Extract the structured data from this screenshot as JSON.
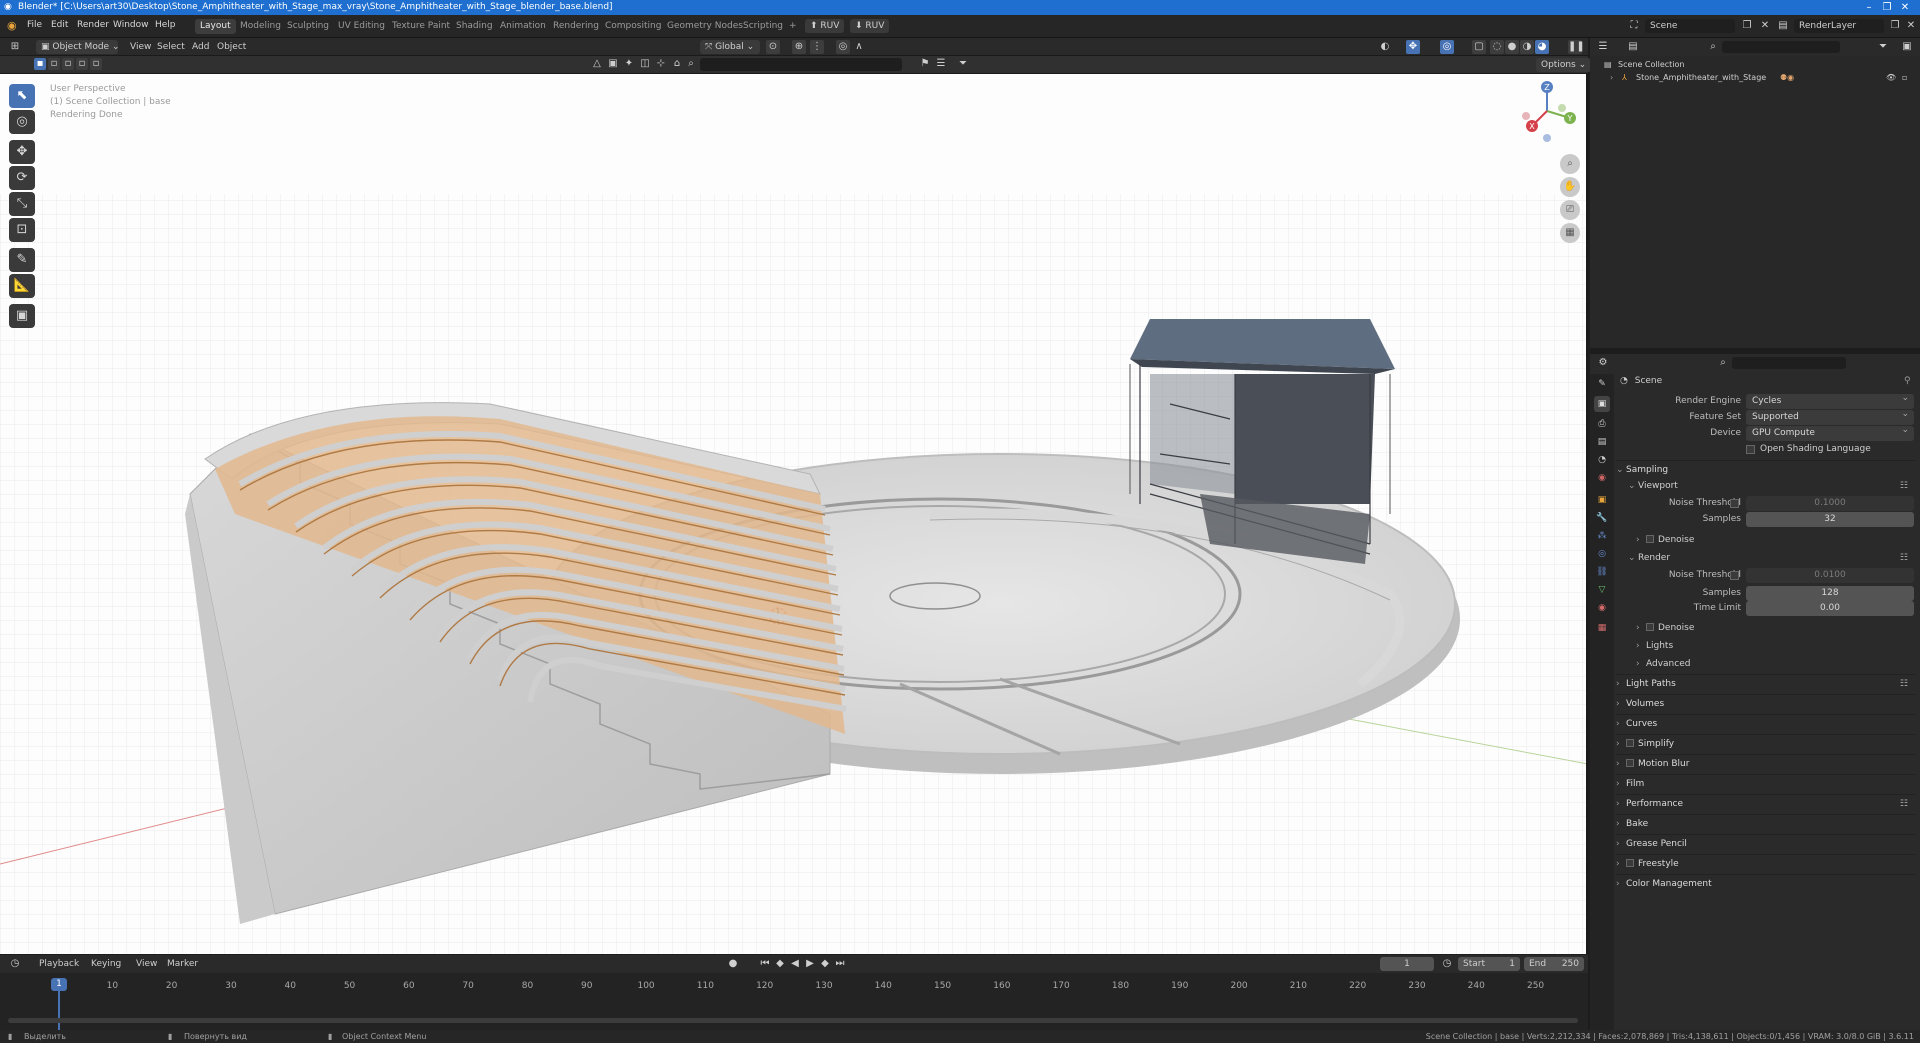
{
  "window": {
    "title": "Blender* [C:\\Users\\art30\\Desktop\\Stone_Amphitheater_with_Stage_max_vray\\Stone_Amphitheater_with_Stage_blender_base.blend]",
    "minimize": "–",
    "maximize": "❐",
    "close": "✕"
  },
  "menus": [
    "File",
    "Edit",
    "Render",
    "Window",
    "Help"
  ],
  "workspaces": [
    "Layout",
    "Modeling",
    "Sculpting",
    "UV Editing",
    "Texture Paint",
    "Shading",
    "Animation",
    "Rendering",
    "Compositing",
    "Geometry Nodes",
    "Scripting"
  ],
  "workspace_add": "+",
  "ruv_labels": [
    "RUV",
    "RUV"
  ],
  "scene_selector": "Scene",
  "view_layer": "RenderLayer",
  "viewport_header": {
    "mode": "Object Mode",
    "menus": [
      "View",
      "Select",
      "Add",
      "Object"
    ],
    "transform": "Global",
    "options": "Options"
  },
  "viewport_info": {
    "line1": "User Perspective",
    "line2": "(1) Scene Collection | base",
    "line3": "Rendering Done"
  },
  "gizmo": {
    "x": "X",
    "y": "Y",
    "z": "Z"
  },
  "outliner": {
    "root": "Scene Collection",
    "child": "Stone_Amphitheater_with_Stage"
  },
  "properties": {
    "context": "Scene",
    "render_engine_label": "Render Engine",
    "render_engine": "Cycles",
    "feature_set_label": "Feature Set",
    "feature_set": "Supported",
    "device_label": "Device",
    "device": "GPU Compute",
    "osl": "Open Shading Language",
    "sampling": "Sampling",
    "viewport": "Viewport",
    "noise_threshold_label": "Noise Threshold",
    "vp_noise_threshold": "0.1000",
    "samples_label": "Samples",
    "vp_samples": "32",
    "denoise": "Denoise",
    "render": "Render",
    "r_noise_threshold": "0.0100",
    "r_samples": "128",
    "time_limit_label": "Time Limit",
    "time_limit": "0.00",
    "lights": "Lights",
    "advanced": "Advanced",
    "panels": [
      "Light Paths",
      "Volumes",
      "Curves",
      "Simplify",
      "Motion Blur",
      "Film",
      "Performance",
      "Bake",
      "Grease Pencil",
      "Freestyle",
      "Color Management"
    ]
  },
  "timeline": {
    "menus": [
      "Playback",
      "Keying",
      "View",
      "Marker"
    ],
    "current_frame": "1",
    "start_label": "Start",
    "start": "1",
    "end_label": "End",
    "end": "250",
    "playhead": "1",
    "ticks": [
      "10",
      "20",
      "30",
      "40",
      "50",
      "60",
      "70",
      "80",
      "90",
      "100",
      "110",
      "120",
      "130",
      "140",
      "150",
      "160",
      "170",
      "180",
      "190",
      "200",
      "210",
      "220",
      "230",
      "240",
      "250"
    ]
  },
  "status": {
    "select": "Выделить",
    "rotate": "Повернуть вид",
    "context_menu": "Object Context Menu",
    "stats": "Scene Collection | base | Verts:2,212,334 | Faces:2,078,869 | Tris:4,138,611 | Objects:0/1,456 | VRAM: 3.0/8.0 GiB | 3.6.11"
  },
  "colors": {
    "titlebar": "#1e6fcf",
    "accent": "#4772b3",
    "panel": "#2a2a2a"
  }
}
